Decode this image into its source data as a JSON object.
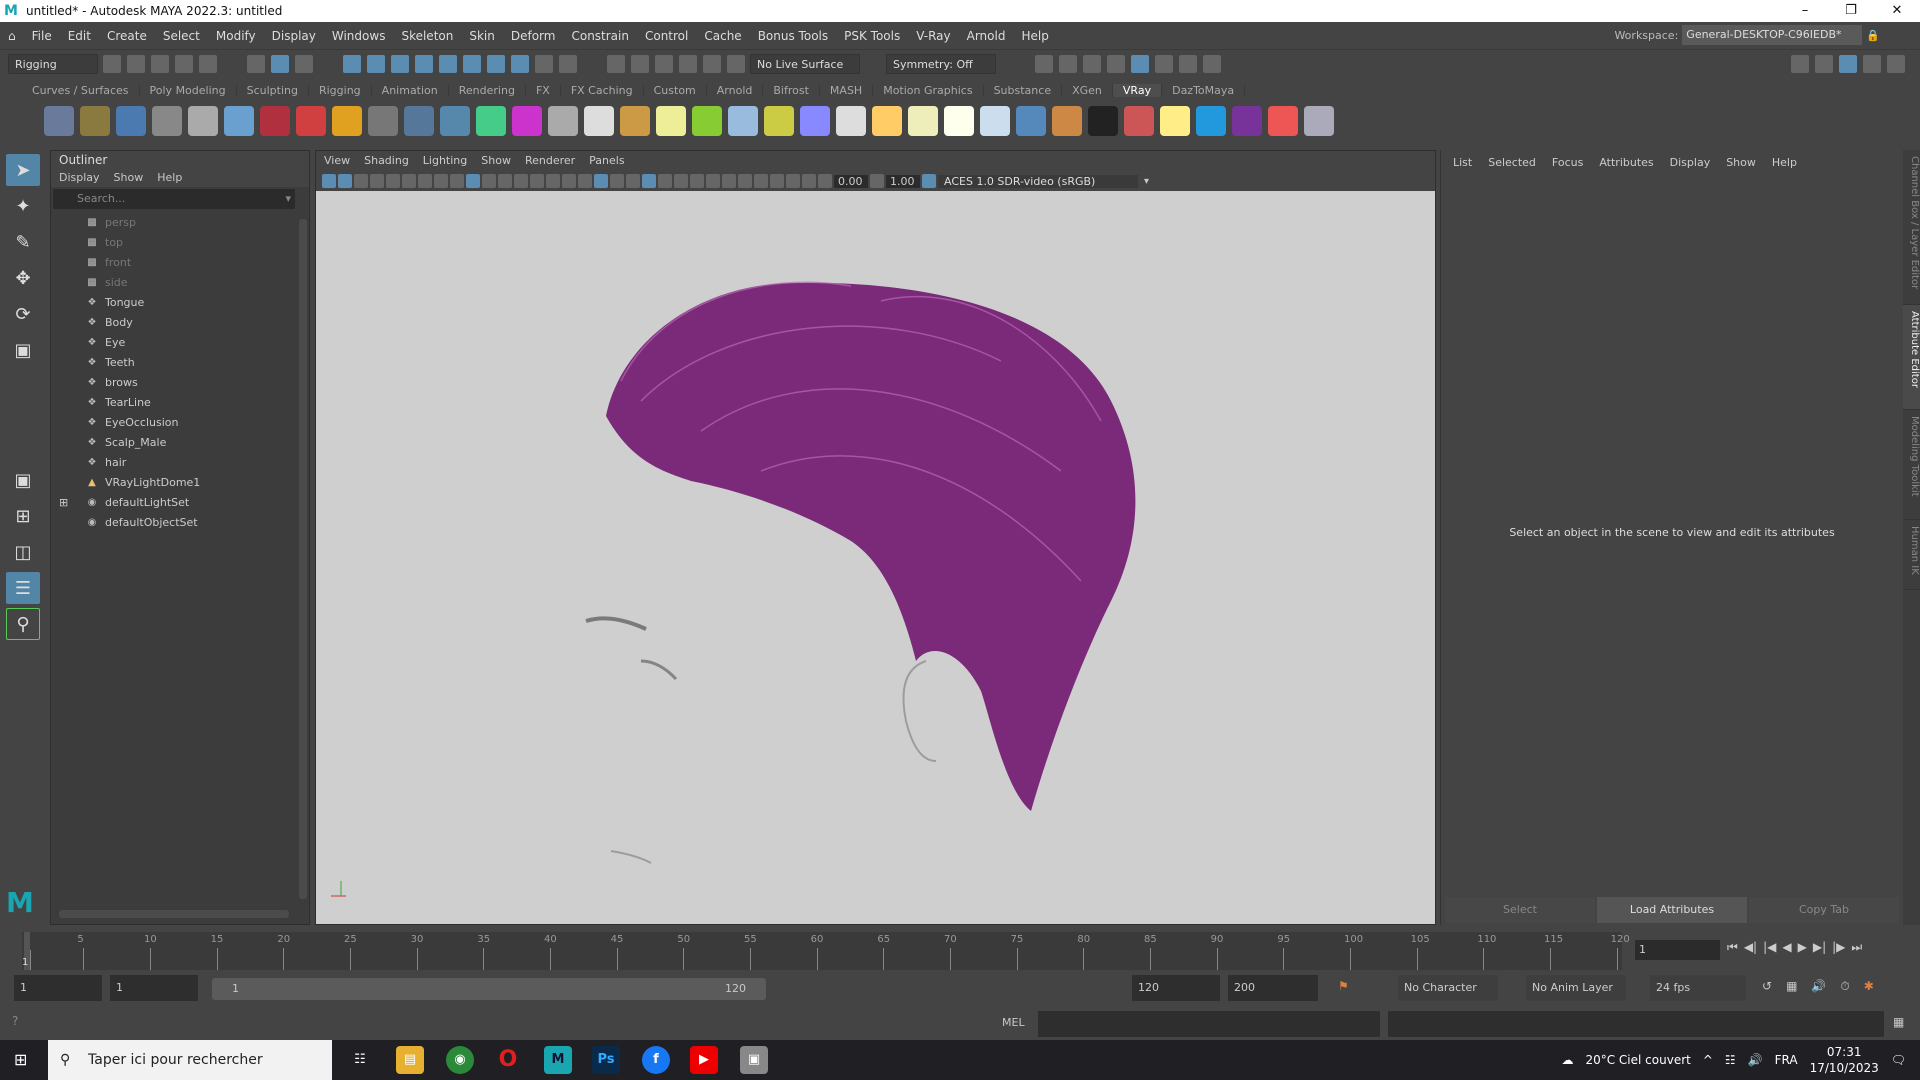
{
  "title": "untitled* - Autodesk MAYA 2022.3: untitled",
  "menus": [
    "File",
    "Edit",
    "Create",
    "Select",
    "Modify",
    "Display",
    "Windows",
    "Skeleton",
    "Skin",
    "Deform",
    "Constrain",
    "Control",
    "Cache",
    "Bonus Tools",
    "PSK Tools",
    "V-Ray",
    "Arnold",
    "Help"
  ],
  "workspace": {
    "label": "Workspace:",
    "value": "General-DESKTOP-C96IEDB*"
  },
  "statusline": {
    "mode": "Rigging",
    "live_surface": "No Live Surface",
    "symmetry": "Symmetry: Off"
  },
  "shelf_tabs": [
    "Curves / Surfaces",
    "Poly Modeling",
    "Sculpting",
    "Rigging",
    "Animation",
    "Rendering",
    "FX",
    "FX Caching",
    "Custom",
    "Arnold",
    "Bifrost",
    "MASH",
    "Motion Graphics",
    "Substance",
    "XGen",
    "VRay",
    "DazToMaya"
  ],
  "shelf_active": "VRay",
  "outliner": {
    "title": "Outliner",
    "menu": [
      "Display",
      "Show",
      "Help"
    ],
    "search_placeholder": "Search...",
    "items": [
      {
        "label": "persp",
        "icon": "camera",
        "dim": true
      },
      {
        "label": "top",
        "icon": "camera",
        "dim": true
      },
      {
        "label": "front",
        "icon": "camera",
        "dim": true
      },
      {
        "label": "side",
        "icon": "camera",
        "dim": true
      },
      {
        "label": "Tongue",
        "icon": "transform"
      },
      {
        "label": "Body",
        "icon": "transform"
      },
      {
        "label": "Eye",
        "icon": "transform"
      },
      {
        "label": "Teeth",
        "icon": "transform"
      },
      {
        "label": "brows",
        "icon": "transform"
      },
      {
        "label": "TearLine",
        "icon": "transform"
      },
      {
        "label": "EyeOcclusion",
        "icon": "transform"
      },
      {
        "label": "Scalp_Male",
        "icon": "transform"
      },
      {
        "label": "hair",
        "icon": "transform"
      },
      {
        "label": "VRayLightDome1",
        "icon": "light"
      },
      {
        "label": "defaultLightSet",
        "icon": "set",
        "expand": true
      },
      {
        "label": "defaultObjectSet",
        "icon": "set"
      }
    ]
  },
  "viewport": {
    "menu": [
      "View",
      "Shading",
      "Lighting",
      "Show",
      "Renderer",
      "Panels"
    ],
    "exposure": "0.00",
    "gamma": "1.00",
    "color_space": "ACES 1.0 SDR-video (sRGB)",
    "hair_color": "#7a2a78",
    "bg_color": "#cfcfcf"
  },
  "attribute_editor": {
    "menu": [
      "List",
      "Selected",
      "Focus",
      "Attributes",
      "Display",
      "Show",
      "Help"
    ],
    "message": "Select an object in the scene to view and edit its attributes",
    "buttons": [
      "Select",
      "Load Attributes",
      "Copy Tab"
    ]
  },
  "side_tabs": [
    "Channel Box / Layer Editor",
    "Attribute Editor",
    "Modeling Toolkit",
    "Human IK"
  ],
  "timeline": {
    "start": 1,
    "end": 120,
    "current": "1",
    "label_step": 5
  },
  "range": {
    "start": "1",
    "inner_start": "1",
    "slider_start": "1",
    "slider_end": "120",
    "end": "120",
    "anim_end": "200",
    "character_set": "No Character Set",
    "anim_layer": "No Anim Layer",
    "fps": "24 fps"
  },
  "command": {
    "lang": "MEL"
  },
  "taskbar": {
    "search": "Taper ici pour rechercher",
    "weather": "20°C  Ciel couvert",
    "lang": "FRA",
    "time": "07:31",
    "date": "17/10/2023"
  }
}
